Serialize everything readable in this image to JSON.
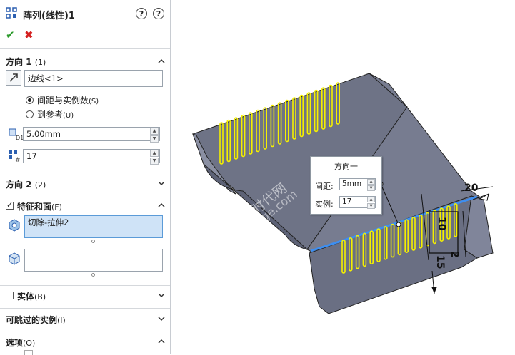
{
  "panel": {
    "title": "阵列(线性)1",
    "direction1": {
      "title": "方向 1",
      "shortcut": "(1)",
      "edge_value": "边线<1>",
      "radio_spacing": "间距与实例数",
      "radio_spacing_key": "(S)",
      "radio_reference": "到参考",
      "radio_reference_key": "(U)",
      "spacing_value": "5.00mm",
      "instances_value": "17"
    },
    "direction2": {
      "title": "方向 2",
      "shortcut": "(2)"
    },
    "features": {
      "title": "特征和面",
      "shortcut": "(F)",
      "checked": true,
      "feature_item": "切除-拉伸2"
    },
    "bodies": {
      "title": "实体",
      "shortcut": "(B)"
    },
    "skip": {
      "title": "可跳过的实例",
      "shortcut": "(I)"
    },
    "options": {
      "title": "选项",
      "shortcut": "(O)"
    }
  },
  "dialog": {
    "title": "方向一",
    "spacing_label": "间距:",
    "spacing_value": "5mm",
    "instances_label": "实例:",
    "instances_value": "17"
  },
  "dimensions": {
    "d20": "20",
    "d10": "10",
    "d2": "2",
    "d15": "15"
  },
  "watermark": {
    "line1": "机械时代网",
    "line2": "www.jxage.com"
  },
  "colors": {
    "slot": "#f5f000",
    "edge_highlight": "#3d8ef0",
    "body": "#6f7489"
  }
}
